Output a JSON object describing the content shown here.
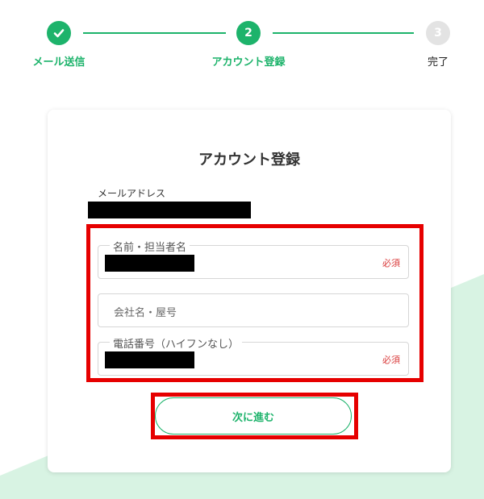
{
  "stepper": {
    "steps": [
      {
        "label": "メール送信",
        "state": "done",
        "number": "✓"
      },
      {
        "label": "アカウント登録",
        "state": "active",
        "number": "2"
      },
      {
        "label": "完了",
        "state": "todo",
        "number": "3"
      }
    ]
  },
  "form": {
    "title": "アカウント登録",
    "email_label": "メールアドレス",
    "email_value_redacted": true,
    "fields": [
      {
        "label": "名前・担当者名",
        "required_text": "必須",
        "value_redacted": true
      },
      {
        "placeholder": "会社名・屋号"
      },
      {
        "label": "電話番号（ハイフンなし）",
        "required_text": "必須",
        "value_redacted": true
      }
    ],
    "submit_label": "次に進む"
  },
  "colors": {
    "accent": "#1db36b",
    "required": "#d93a3a",
    "highlight": "#e60000",
    "background_wedge": "#d8f3e3"
  }
}
